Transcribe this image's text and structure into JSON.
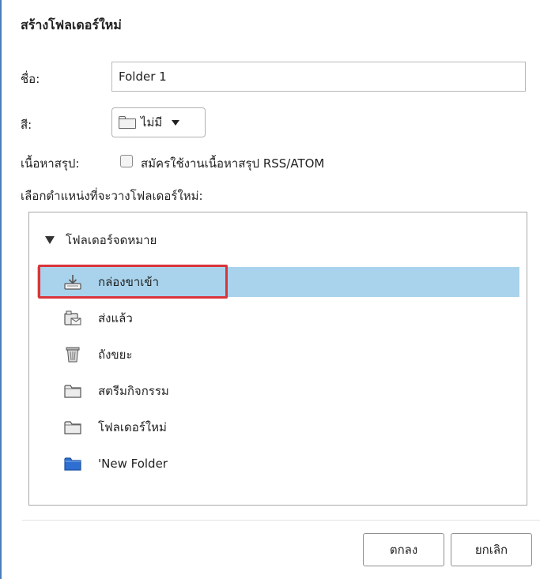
{
  "dialog": {
    "title": "สร้างโฟลเดอร์ใหม่"
  },
  "form": {
    "name_label": "ชื่อ:",
    "name_value": "Folder 1",
    "color_label": "สี:",
    "color_value": "ไม่มี",
    "rss_label": "เนื้อหาสรุป:",
    "rss_option": "สมัครใช้งานเนื้อหาสรุป RSS/ATOM",
    "rss_checked": false,
    "location_label": "เลือกตำแหน่งที่จะวางโฟลเดอร์ใหม่:"
  },
  "tree": {
    "root": {
      "label": "โฟลเดอร์จดหมาย",
      "expanded": true
    },
    "items": [
      {
        "label": "กล่องขาเข้า",
        "icon": "inbox-icon",
        "selected": true
      },
      {
        "label": "ส่งแล้ว",
        "icon": "sent-icon",
        "selected": false
      },
      {
        "label": "ถังขยะ",
        "icon": "trash-icon",
        "selected": false
      },
      {
        "label": "สตรีมกิจกรรม",
        "icon": "folder-icon",
        "selected": false
      },
      {
        "label": "โฟลเดอร์ใหม่",
        "icon": "folder-icon",
        "selected": false
      },
      {
        "label": "'New Folder",
        "icon": "blue-folder-icon",
        "selected": false
      }
    ]
  },
  "buttons": {
    "ok": "ตกลง",
    "cancel": "ยกเลิก"
  },
  "colors": {
    "selected_row": "#a9d3ec",
    "highlight_border": "#d9343a",
    "accent_folder": "#2f6fd1"
  }
}
